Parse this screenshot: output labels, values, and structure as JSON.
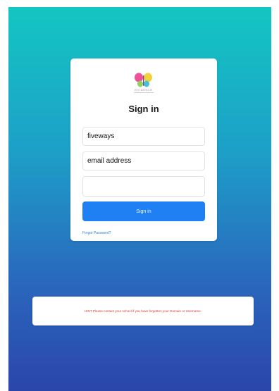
{
  "brand": {
    "logo_icon": "butterfly-logo-icon",
    "logo_text": "EVIDENCE",
    "colors": {
      "wing_left": "#f0509a",
      "wing_right": "#f2d13a",
      "wing_bottom_left": "#8fd15c",
      "wing_bottom_right": "#45c1d9"
    }
  },
  "signin": {
    "title": "Sign in",
    "domain_value": "fiveways",
    "email_value": "email address",
    "password_value": "",
    "submit_label": "Sign in",
    "forgot_label": "Forgot Password?"
  },
  "hint": {
    "text": "HINT Please contact your school if you have forgotten your Domain or Username."
  },
  "colors": {
    "gradient_top": "#13c6c2",
    "gradient_bottom": "#2b45ab",
    "button": "#1f80f3",
    "hint_text": "#d83a3a"
  }
}
